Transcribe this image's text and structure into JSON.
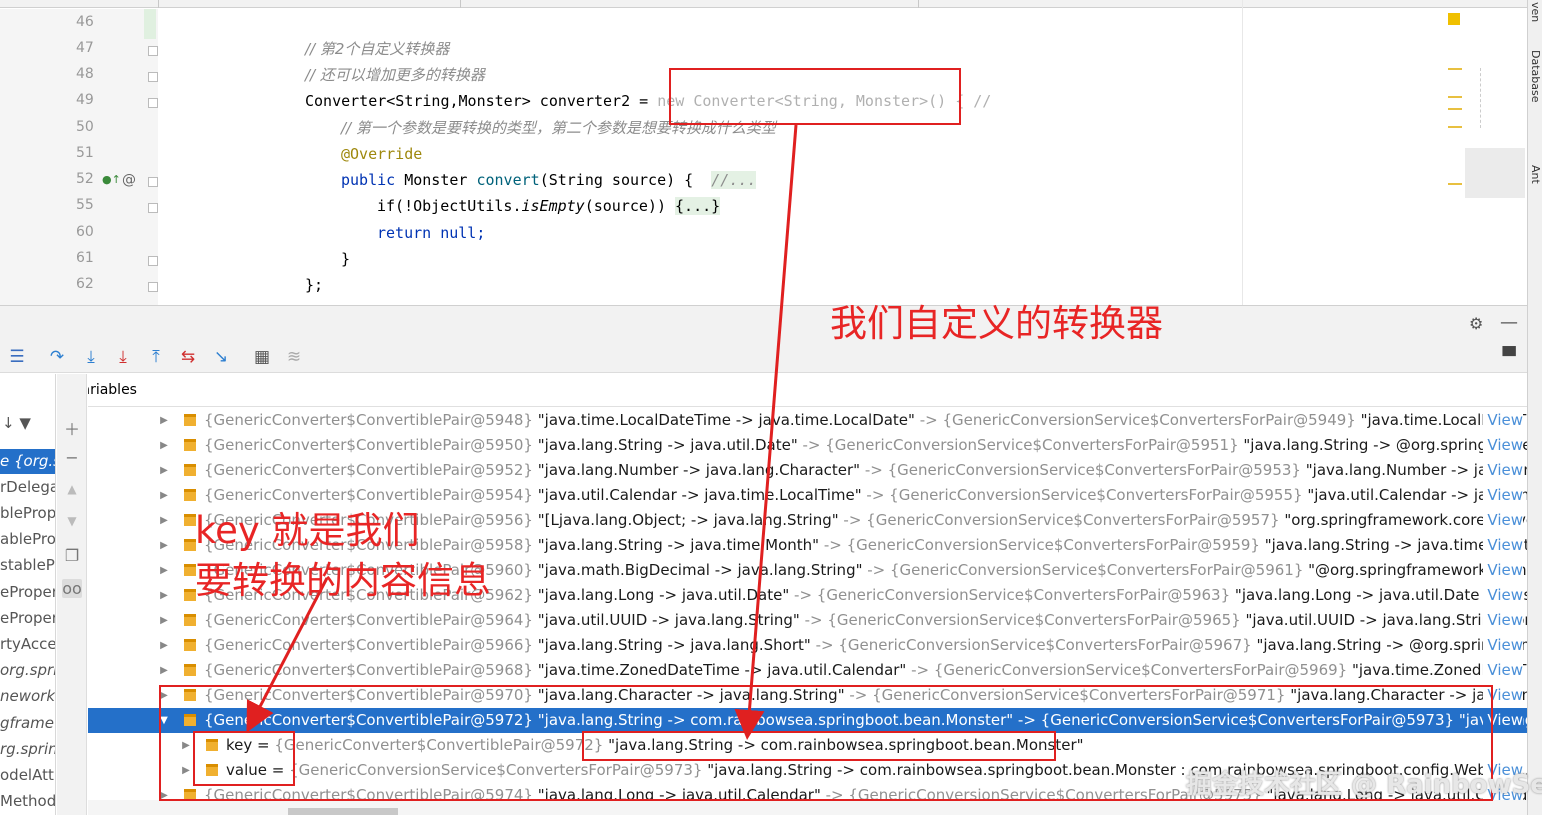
{
  "editor": {
    "lines": [
      {
        "num": "46",
        "code": ""
      },
      {
        "num": "47",
        "code": "// 第2个自定义转换器"
      },
      {
        "num": "48",
        "code": "// 还可以增加更多的转换器"
      },
      {
        "num": "49",
        "code_a": "Converter<String,Monster> converter2 = ",
        "code_b": "new Converter<String, Monster>() { //"
      },
      {
        "num": "50",
        "code": "// 第一个参数是要转换的类型，第二个参数是想要转换成什么类型"
      },
      {
        "num": "51",
        "code": "@Override"
      },
      {
        "num": "52",
        "kw": "public ",
        "type": "Monster ",
        "fn": "convert",
        "rest": "(String source) {  ",
        "fold": "//..."
      },
      {
        "num": "55",
        "a": "if(!ObjectUtils.",
        "b": "isEmpty",
        "c": "(source)) ",
        "fold": "{...}"
      },
      {
        "num": "60",
        "kw": "return ",
        "rest": "null;"
      },
      {
        "num": "61",
        "code": "}"
      },
      {
        "num": "62",
        "code": "};"
      }
    ]
  },
  "right_tabs": [
    "ven",
    "Database",
    "Ant"
  ],
  "debug": {
    "variables_label": "Variables",
    "frames": [
      "",
      "e {org.sp",
      "rDelega",
      "bleProp",
      "ableProp",
      "stablePr",
      "ePropert",
      "ePropert",
      "rtyAcces",
      "org.spri",
      "nework.",
      "gframew",
      "rg.sprin",
      "odelAttr",
      "Method"
    ]
  },
  "variables": {
    "rows": [
      {
        "left": "{GenericConverter$ConvertiblePair@5948} ",
        "mid": "\"java.time.LocalDateTime -> java.time.LocalDate\"",
        "arrow": " -> {GenericConversionService$ConvertersForPair@5949} ",
        "right": "\"java.time.LocalDateTim...",
        "view": "View"
      },
      {
        "left": "{GenericConverter$ConvertiblePair@5950} ",
        "mid": "\"java.lang.String -> java.util.Date\"",
        "arrow": " -> {GenericConversionService$ConvertersForPair@5951} ",
        "right": "\"java.lang.String -> @org.springframew...",
        "view": "View"
      },
      {
        "left": "{GenericConverter$ConvertiblePair@5952} ",
        "mid": "\"java.lang.Number -> java.lang.Character\"",
        "arrow": " -> {GenericConversionService$ConvertersForPair@5953} ",
        "right": "\"java.lang.Number -> java.lang...",
        "view": "View"
      },
      {
        "left": "{GenericConverter$ConvertiblePair@5954} ",
        "mid": "\"java.util.Calendar -> java.time.LocalTime\"",
        "arrow": " -> {GenericConversionService$ConvertersForPair@5955} ",
        "right": "\"java.util.Calendar -> java.time...",
        "view": "View"
      },
      {
        "left": "{GenericConverter$ConvertiblePair@5956} ",
        "mid": "\"[Ljava.lang.Object; -> java.lang.String\"",
        "arrow": " -> {GenericConversionService$ConvertersForPair@5957} ",
        "right": "\"org.springframework.core.conve...",
        "view": "View"
      },
      {
        "left": "{GenericConverter$ConvertiblePair@5958} ",
        "mid": "\"java.lang.String -> java.time.Month\"",
        "arrow": " -> {GenericConversionService$ConvertersForPair@5959} ",
        "right": "\"java.lang.String -> java.time.Month...",
        "view": "View"
      },
      {
        "left": "{GenericConverter$ConvertiblePair@5960} ",
        "mid": "\"java.math.BigDecimal -> java.lang.String\"",
        "arrow": " -> {GenericConversionService$ConvertersForPair@5961} ",
        "right": "\"@org.springframework.format...",
        "view": "View"
      },
      {
        "left": "{GenericConverter$ConvertiblePair@5962} ",
        "mid": "\"java.lang.Long -> java.util.Date\"",
        "arrow": " -> {GenericConversionService$ConvertersForPair@5963} ",
        "right": "\"java.lang.Long -> java.util.Date : org.spr...",
        "view": "View"
      },
      {
        "left": "{GenericConverter$ConvertiblePair@5964} ",
        "mid": "\"java.util.UUID -> java.lang.String\"",
        "arrow": " -> {GenericConversionService$ConvertersForPair@5965} ",
        "right": "\"java.util.UUID -> java.lang.String : org.s...",
        "view": "View"
      },
      {
        "left": "{GenericConverter$ConvertiblePair@5966} ",
        "mid": "\"java.lang.String -> java.lang.Short\"",
        "arrow": " -> {GenericConversionService$ConvertersForPair@5967} ",
        "right": "\"java.lang.String -> @org.springframe...",
        "view": "View"
      },
      {
        "left": "{GenericConverter$ConvertiblePair@5968} ",
        "mid": "\"java.time.ZonedDateTime -> java.util.Calendar\"",
        "arrow": " -> {GenericConversionService$ConvertersForPair@5969} ",
        "right": "\"java.time.ZonedDateTim...",
        "view": "View"
      },
      {
        "left": "{GenericConverter$ConvertiblePair@5970} ",
        "mid": "\"java.lang.Character -> java.lang.String\"",
        "arrow": " -> {GenericConversionService$ConvertersForPair@5971} ",
        "right": "\"java.lang.Character -> java.lang.S...",
        "view": "View"
      },
      {
        "left": "{GenericConverter$ConvertiblePair@5972} ",
        "mid": "\"java.lang.String -> com.rainbowsea.springboot.bean.Monster\"",
        "arrow": " -> {GenericConversionService$ConvertersForPair@5973} ",
        "right": "\"java.lang...",
        "view": "View"
      },
      {
        "left": "{GenericConverter$ConvertiblePair@5974} ",
        "mid": "\"java.lang.Long -> java.util.Calendar\"",
        "arrow": " -> {GenericConversionService$ConvertersForPair@5975} ",
        "right": "\"java.lang.Long -> java.util.Calendar...",
        "view": "View"
      }
    ],
    "key_row": {
      "name": "key",
      "eq": " = ",
      "type": "{GenericConverter$ConvertiblePair@5972} ",
      "val": "\"java.lang.String -> com.rainbowsea.springboot.bean.Monster\""
    },
    "value_row": {
      "name": "value",
      "eq": " = ",
      "type": "{GenericConversionService$ConvertersForPair@5973} ",
      "val": "\"java.lang.String -> com.rainbowsea.springboot.bean.Monster : com.rainbowsea.springboot.config.WebConf...",
      "view": "View"
    }
  },
  "annotations": {
    "custom_converter": "我们自定义的转换器",
    "key_line1": "key 就是我们",
    "key_line2": "要转换的内容信息"
  },
  "watermark": "掘金技术社区 @ RainbowSea",
  "colors": {
    "annotation_red": "#e82525",
    "selection_blue": "#2470c9",
    "link_blue": "#4a8fd8"
  }
}
